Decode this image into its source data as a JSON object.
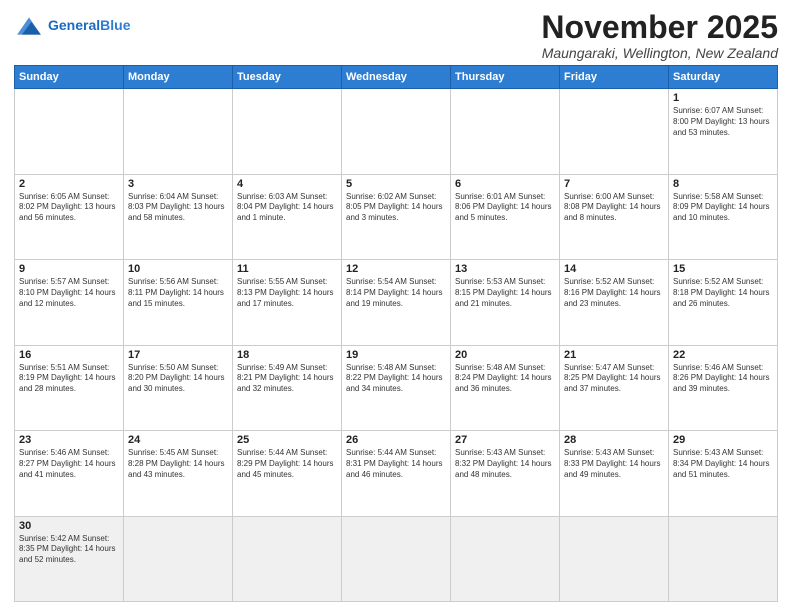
{
  "header": {
    "logo_general": "General",
    "logo_blue": "Blue",
    "month_title": "November 2025",
    "location": "Maungaraki, Wellington, New Zealand"
  },
  "days_of_week": [
    "Sunday",
    "Monday",
    "Tuesday",
    "Wednesday",
    "Thursday",
    "Friday",
    "Saturday"
  ],
  "weeks": [
    [
      {
        "day": "",
        "info": ""
      },
      {
        "day": "",
        "info": ""
      },
      {
        "day": "",
        "info": ""
      },
      {
        "day": "",
        "info": ""
      },
      {
        "day": "",
        "info": ""
      },
      {
        "day": "",
        "info": ""
      },
      {
        "day": "1",
        "info": "Sunrise: 6:07 AM\nSunset: 8:00 PM\nDaylight: 13 hours and 53 minutes."
      }
    ],
    [
      {
        "day": "2",
        "info": "Sunrise: 6:05 AM\nSunset: 8:02 PM\nDaylight: 13 hours and 56 minutes."
      },
      {
        "day": "3",
        "info": "Sunrise: 6:04 AM\nSunset: 8:03 PM\nDaylight: 13 hours and 58 minutes."
      },
      {
        "day": "4",
        "info": "Sunrise: 6:03 AM\nSunset: 8:04 PM\nDaylight: 14 hours and 1 minute."
      },
      {
        "day": "5",
        "info": "Sunrise: 6:02 AM\nSunset: 8:05 PM\nDaylight: 14 hours and 3 minutes."
      },
      {
        "day": "6",
        "info": "Sunrise: 6:01 AM\nSunset: 8:06 PM\nDaylight: 14 hours and 5 minutes."
      },
      {
        "day": "7",
        "info": "Sunrise: 6:00 AM\nSunset: 8:08 PM\nDaylight: 14 hours and 8 minutes."
      },
      {
        "day": "8",
        "info": "Sunrise: 5:58 AM\nSunset: 8:09 PM\nDaylight: 14 hours and 10 minutes."
      }
    ],
    [
      {
        "day": "9",
        "info": "Sunrise: 5:57 AM\nSunset: 8:10 PM\nDaylight: 14 hours and 12 minutes."
      },
      {
        "day": "10",
        "info": "Sunrise: 5:56 AM\nSunset: 8:11 PM\nDaylight: 14 hours and 15 minutes."
      },
      {
        "day": "11",
        "info": "Sunrise: 5:55 AM\nSunset: 8:13 PM\nDaylight: 14 hours and 17 minutes."
      },
      {
        "day": "12",
        "info": "Sunrise: 5:54 AM\nSunset: 8:14 PM\nDaylight: 14 hours and 19 minutes."
      },
      {
        "day": "13",
        "info": "Sunrise: 5:53 AM\nSunset: 8:15 PM\nDaylight: 14 hours and 21 minutes."
      },
      {
        "day": "14",
        "info": "Sunrise: 5:52 AM\nSunset: 8:16 PM\nDaylight: 14 hours and 23 minutes."
      },
      {
        "day": "15",
        "info": "Sunrise: 5:52 AM\nSunset: 8:18 PM\nDaylight: 14 hours and 26 minutes."
      }
    ],
    [
      {
        "day": "16",
        "info": "Sunrise: 5:51 AM\nSunset: 8:19 PM\nDaylight: 14 hours and 28 minutes."
      },
      {
        "day": "17",
        "info": "Sunrise: 5:50 AM\nSunset: 8:20 PM\nDaylight: 14 hours and 30 minutes."
      },
      {
        "day": "18",
        "info": "Sunrise: 5:49 AM\nSunset: 8:21 PM\nDaylight: 14 hours and 32 minutes."
      },
      {
        "day": "19",
        "info": "Sunrise: 5:48 AM\nSunset: 8:22 PM\nDaylight: 14 hours and 34 minutes."
      },
      {
        "day": "20",
        "info": "Sunrise: 5:48 AM\nSunset: 8:24 PM\nDaylight: 14 hours and 36 minutes."
      },
      {
        "day": "21",
        "info": "Sunrise: 5:47 AM\nSunset: 8:25 PM\nDaylight: 14 hours and 37 minutes."
      },
      {
        "day": "22",
        "info": "Sunrise: 5:46 AM\nSunset: 8:26 PM\nDaylight: 14 hours and 39 minutes."
      }
    ],
    [
      {
        "day": "23",
        "info": "Sunrise: 5:46 AM\nSunset: 8:27 PM\nDaylight: 14 hours and 41 minutes."
      },
      {
        "day": "24",
        "info": "Sunrise: 5:45 AM\nSunset: 8:28 PM\nDaylight: 14 hours and 43 minutes."
      },
      {
        "day": "25",
        "info": "Sunrise: 5:44 AM\nSunset: 8:29 PM\nDaylight: 14 hours and 45 minutes."
      },
      {
        "day": "26",
        "info": "Sunrise: 5:44 AM\nSunset: 8:31 PM\nDaylight: 14 hours and 46 minutes."
      },
      {
        "day": "27",
        "info": "Sunrise: 5:43 AM\nSunset: 8:32 PM\nDaylight: 14 hours and 48 minutes."
      },
      {
        "day": "28",
        "info": "Sunrise: 5:43 AM\nSunset: 8:33 PM\nDaylight: 14 hours and 49 minutes."
      },
      {
        "day": "29",
        "info": "Sunrise: 5:43 AM\nSunset: 8:34 PM\nDaylight: 14 hours and 51 minutes."
      }
    ],
    [
      {
        "day": "30",
        "info": "Sunrise: 5:42 AM\nSunset: 8:35 PM\nDaylight: 14 hours and 52 minutes."
      },
      {
        "day": "",
        "info": ""
      },
      {
        "day": "",
        "info": ""
      },
      {
        "day": "",
        "info": ""
      },
      {
        "day": "",
        "info": ""
      },
      {
        "day": "",
        "info": ""
      },
      {
        "day": "",
        "info": ""
      }
    ]
  ]
}
